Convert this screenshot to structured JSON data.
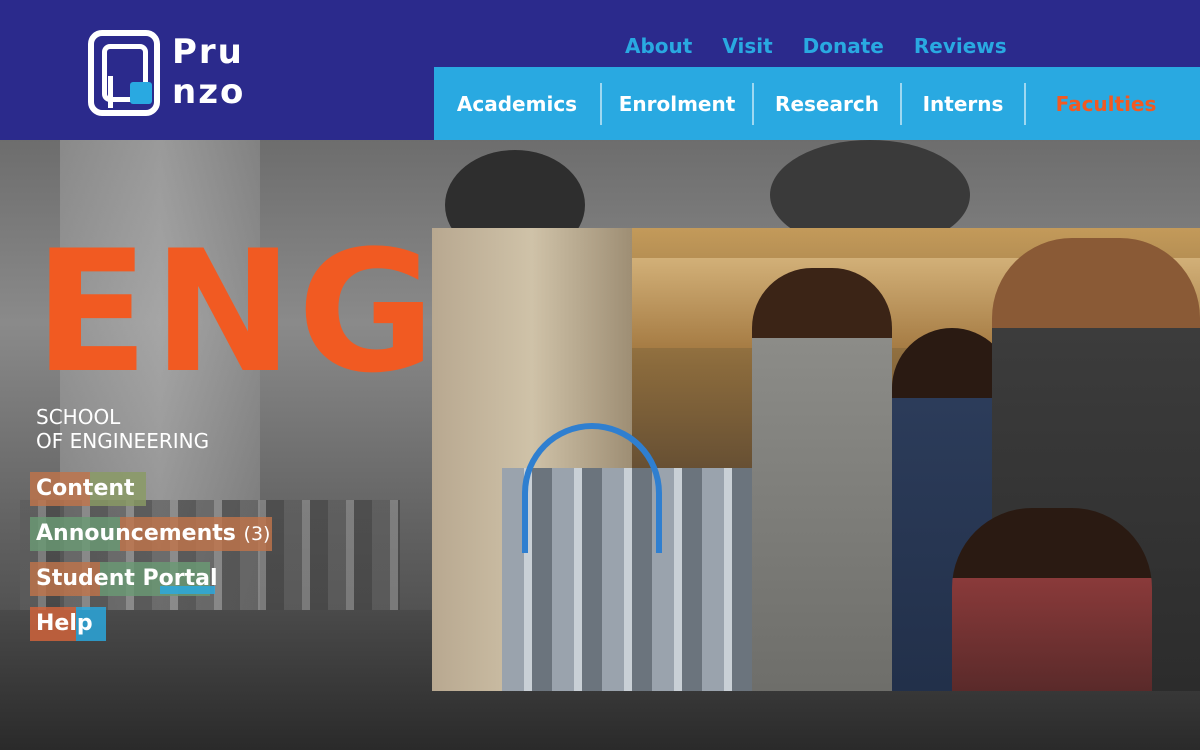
{
  "logo": {
    "text_line1": "Pru",
    "text_line2": "nzo"
  },
  "util_nav": [
    "About",
    "Visit",
    "Donate",
    "Reviews"
  ],
  "main_nav": {
    "items": [
      "Academics",
      "Enrolment",
      "Research",
      "Interns",
      "Faculties"
    ],
    "active": "Faculties"
  },
  "hero": {
    "title": "ENG",
    "subtitle_line1": "SCHOOL",
    "subtitle_line2": "OF ENGINEERING"
  },
  "side_links": {
    "content": "Content",
    "announcements": "Announcements",
    "announcements_count": "(3)",
    "student_portal": "Student Portal",
    "help": "Help"
  },
  "colors": {
    "header_bg": "#2b2a8c",
    "accent_blue": "#29a9e1",
    "accent_orange": "#f15a22"
  }
}
